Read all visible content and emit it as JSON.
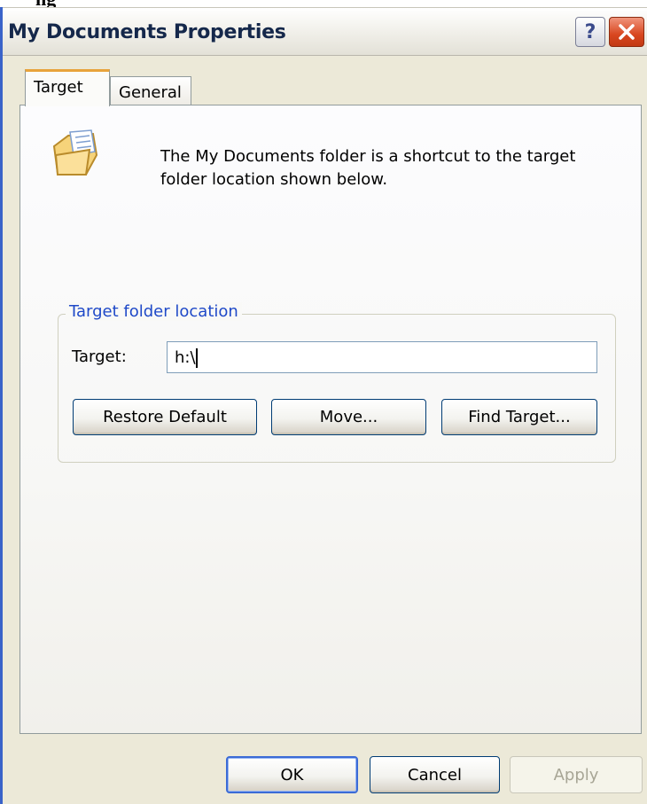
{
  "top_fragment": "ng",
  "window": {
    "title": "My Documents Properties",
    "help_glyph": "?"
  },
  "tabs": [
    {
      "label": "Target",
      "active": true
    },
    {
      "label": "General",
      "active": false
    }
  ],
  "description": "The My Documents folder is a shortcut to the target folder location shown below.",
  "group": {
    "legend": "Target folder location",
    "target_label": "Target:",
    "target_value": "h:\\",
    "buttons": {
      "restore": "Restore Default",
      "move": "Move...",
      "find": "Find Target..."
    }
  },
  "dialog_buttons": {
    "ok": "OK",
    "cancel": "Cancel",
    "apply": "Apply"
  },
  "colors": {
    "accent_tab": "#e8a33b",
    "group_legend": "#1f49c8",
    "close_button": "#d8461f"
  }
}
